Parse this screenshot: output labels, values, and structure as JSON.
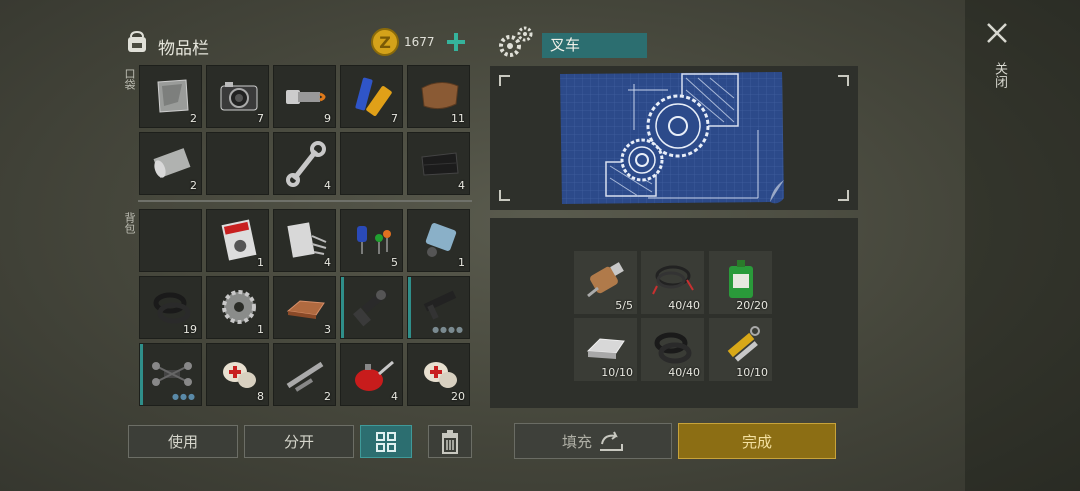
{
  "inventory": {
    "title": "物品栏",
    "coins": "1677",
    "pocket_label": "口袋",
    "backpack_label": "背包",
    "pocket_slots": [
      {
        "icon": "metal-plate-icon",
        "count": "2"
      },
      {
        "icon": "camera-icon",
        "count": "7"
      },
      {
        "icon": "flashlight-icon",
        "count": "9"
      },
      {
        "icon": "batteries-icon",
        "count": "7"
      },
      {
        "icon": "leather-icon",
        "count": "11"
      },
      {
        "icon": "sheet-roll-icon",
        "count": "2"
      },
      {
        "icon": "empty-slot",
        "count": ""
      },
      {
        "icon": "wrench-icon",
        "count": "4"
      },
      {
        "icon": "empty-slot",
        "count": ""
      },
      {
        "icon": "black-cloth-icon",
        "count": "4"
      }
    ],
    "backpack_slots": [
      {
        "icon": "empty-slot",
        "count": ""
      },
      {
        "icon": "motorcycle-magazine-icon",
        "count": "1"
      },
      {
        "icon": "nails-bag-icon",
        "count": "4"
      },
      {
        "icon": "electronic-components-icon",
        "count": "5"
      },
      {
        "icon": "gas-canister-icon",
        "count": "1"
      },
      {
        "icon": "rubber-gasket-icon",
        "count": "19"
      },
      {
        "icon": "gear-icon",
        "count": "1"
      },
      {
        "icon": "copper-ingot-icon",
        "count": "3"
      },
      {
        "icon": "grenade-launcher-icon",
        "count": ""
      },
      {
        "icon": "smg-icon",
        "count": ""
      },
      {
        "icon": "drone-icon",
        "count": ""
      },
      {
        "icon": "first-aid-bandage-icon",
        "count": "8"
      },
      {
        "icon": "metal-rods-icon",
        "count": "2"
      },
      {
        "icon": "oil-can-icon",
        "count": "4"
      },
      {
        "icon": "first-aid-bandage-icon",
        "count": "20"
      }
    ],
    "buttons": {
      "use": "使用",
      "split": "分开"
    }
  },
  "craft": {
    "item_name": "叉车",
    "ingredients": [
      {
        "icon": "electric-motor-icon",
        "count": "5/5"
      },
      {
        "icon": "wires-icon",
        "count": "40/40"
      },
      {
        "icon": "motor-oil-icon",
        "count": "20/20"
      },
      {
        "icon": "steel-ingot-icon",
        "count": "10/10"
      },
      {
        "icon": "rubber-gasket-icon",
        "count": "40/40"
      },
      {
        "icon": "hydraulic-cylinder-icon",
        "count": "10/10"
      }
    ],
    "fill_label": "填充",
    "complete_label": "完成"
  },
  "close_label": "关闭",
  "colors": {
    "accent": "#2c6e70",
    "confirm": "#8c6e14",
    "coin": "#d4a21a"
  }
}
